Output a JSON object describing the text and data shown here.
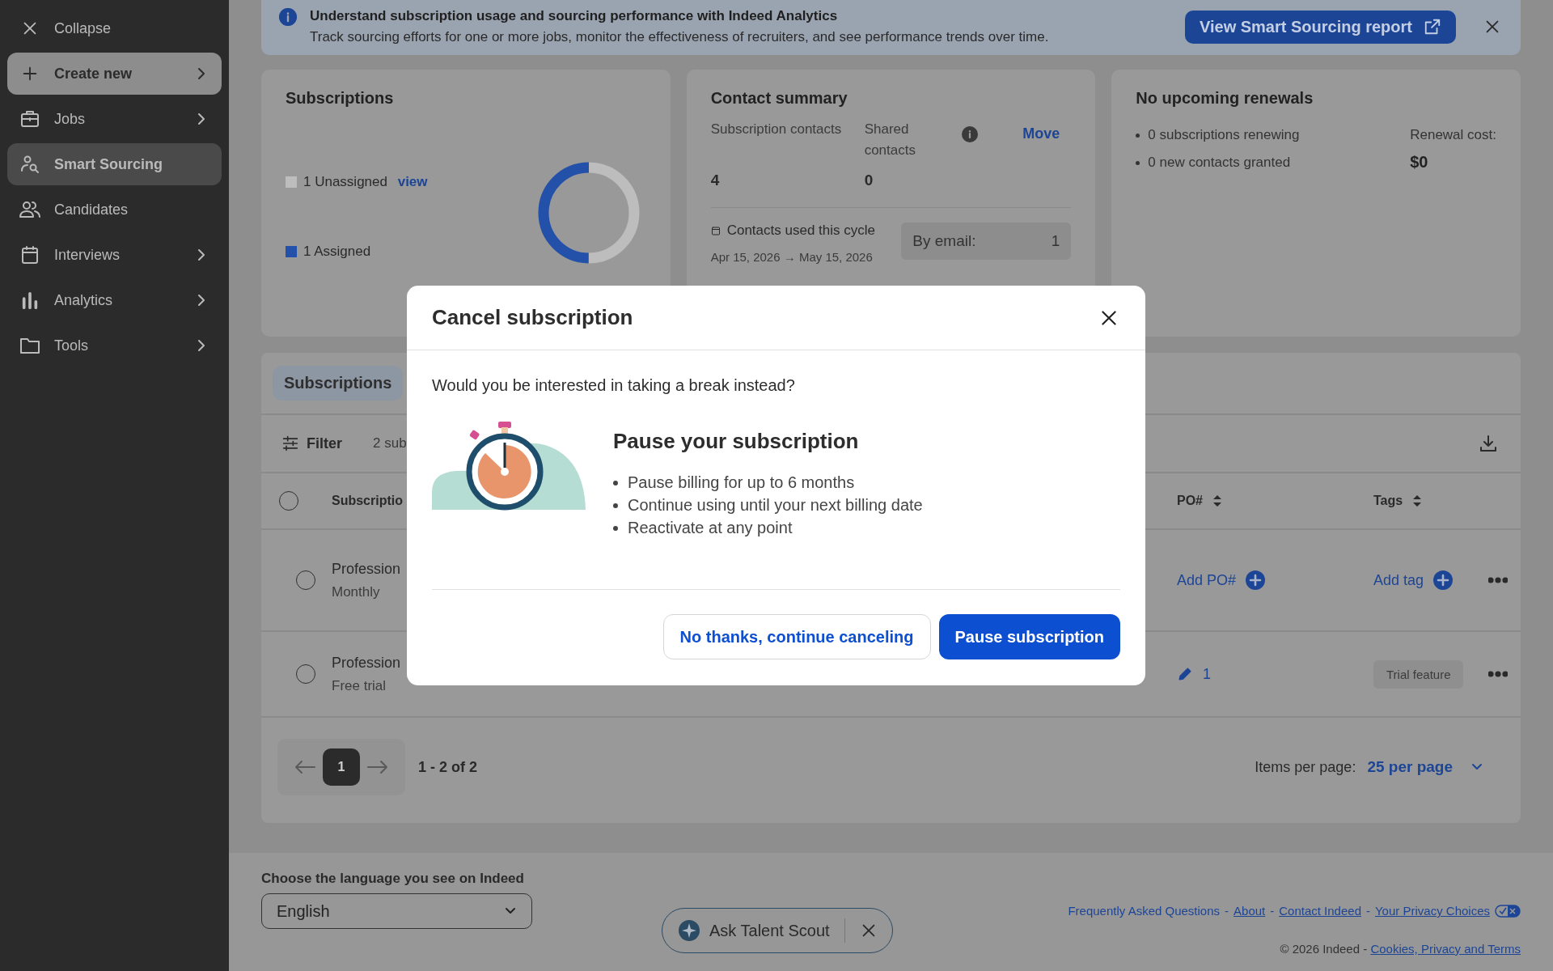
{
  "sidebar": {
    "items": [
      {
        "kind": "collapse",
        "label": "Collapse",
        "has_submenu": false
      },
      {
        "kind": "create",
        "label": "Create new",
        "has_submenu": true
      },
      {
        "kind": "nav",
        "label": "Jobs",
        "selected": false,
        "has_submenu": true
      },
      {
        "kind": "nav",
        "label": "Smart Sourcing",
        "selected": true,
        "has_submenu": false
      },
      {
        "kind": "nav",
        "label": "Candidates",
        "selected": false,
        "has_submenu": false
      },
      {
        "kind": "nav",
        "label": "Interviews",
        "selected": false,
        "has_submenu": true
      },
      {
        "kind": "nav",
        "label": "Analytics",
        "selected": false,
        "has_submenu": true
      },
      {
        "kind": "nav",
        "label": "Tools",
        "selected": false,
        "has_submenu": true
      }
    ]
  },
  "banner": {
    "title": "Understand subscription usage and sourcing performance with Indeed Analytics",
    "text": "Track sourcing efforts for one or more jobs, monitor the effectiveness of recruiters, and see performance trends over time.",
    "button": "View Smart Sourcing report"
  },
  "subscriptions_card": {
    "title": "Subscriptions",
    "legend": [
      {
        "label": "1 Unassigned",
        "color": "#bdbdbd",
        "link": "view"
      },
      {
        "label": "1 Assigned",
        "color": "#2350a8"
      }
    ]
  },
  "contact_summary": {
    "title": "Contact summary",
    "stats": [
      {
        "label": "Subscription contacts",
        "value": "4"
      },
      {
        "label": "Shared contacts",
        "value": "0"
      }
    ],
    "action": "Move",
    "cycle_label": "Contacts used this cycle",
    "cycle_dates": "Apr 15, 2026 → May 15, 2026",
    "by_email_label": "By email:",
    "by_email_value": "1"
  },
  "renewals": {
    "title": "No upcoming renewals",
    "bullets": [
      "0 subscriptions renewing",
      "0 new contacts granted"
    ],
    "cost_label": "Renewal cost:",
    "cost_value": "$0"
  },
  "table": {
    "tabs": [
      {
        "label": "Subscriptions",
        "selected": true
      }
    ],
    "filter": "Filter",
    "count": "2 sub",
    "header_checked": false,
    "columns": [
      "Subscriptio",
      "PO#",
      "Tags"
    ],
    "rows": [
      {
        "name": "Profession",
        "plan": "Monthly",
        "checked": false,
        "po": {
          "kind": "add",
          "label": "Add PO#"
        },
        "tags": {
          "kind": "add",
          "label": "Add tag"
        }
      },
      {
        "name": "Profession",
        "plan": "Free trial",
        "checked": false,
        "po": {
          "kind": "edit",
          "label": "1"
        },
        "tags": {
          "kind": "tag",
          "label": "Trial feature"
        }
      }
    ],
    "pagination": {
      "pages": [
        {
          "label": "1",
          "selected": true
        }
      ],
      "range": "1 - 2 of 2",
      "per_page_label": "Items per page:",
      "per_page": "25 per page"
    }
  },
  "footer": {
    "language_label": "Choose the language you see on Indeed",
    "language": "English",
    "assistant": "Ask Talent Scout",
    "links": [
      {
        "label": "Frequently Asked Questions",
        "underlined": false
      },
      {
        "label": "About",
        "underlined": true
      },
      {
        "label": "Contact Indeed",
        "underlined": true
      },
      {
        "label": "Your Privacy Choices",
        "underlined": true
      }
    ],
    "separator": "-",
    "copyright": "© 2026 Indeed -",
    "legal_link": "Cookies, Privacy and Terms"
  },
  "modal": {
    "title": "Cancel subscription",
    "question": "Would you be interested in taking a break instead?",
    "heading": "Pause your subscription",
    "bullets": [
      "Pause billing for up to 6 months",
      "Continue using until your next billing date",
      "Reactivate at any point"
    ],
    "buttons": [
      {
        "label": "No thanks, continue canceling",
        "kind": "secondary"
      },
      {
        "label": "Pause subscription",
        "kind": "primary"
      }
    ]
  }
}
